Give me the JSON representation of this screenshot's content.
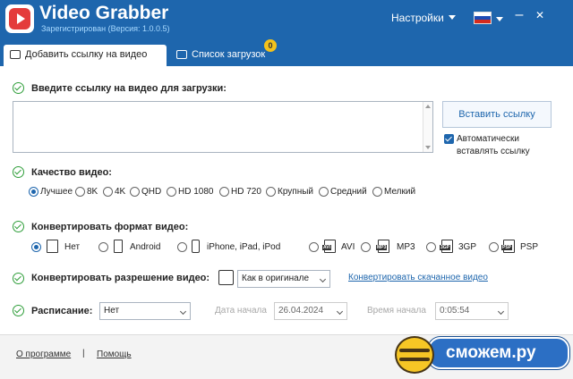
{
  "app": {
    "title": "Video Grabber",
    "subtitle": "Зарегистрирован (Версия: 1.0.0.5)",
    "settings_label": "Настройки",
    "language_flag": "ru-flag",
    "minimize_symbol": "–",
    "close_symbol": "✕"
  },
  "tabs": [
    {
      "label": "Добавить ссылку на видео",
      "active": true,
      "icon": "add-video-icon"
    },
    {
      "label": "Список загрузок",
      "active": false,
      "icon": "download-list-icon",
      "badge": "0"
    }
  ],
  "url_section": {
    "label": "Введите ссылку на видео для загрузки:",
    "input_value": "",
    "paste_button": "Вставить ссылку",
    "auto_paste_label": "Автоматически вставлять ссылку",
    "auto_paste_checked": true
  },
  "quality": {
    "label": "Качество видео:",
    "options": [
      "Лучшее",
      "8K",
      "4K",
      "QHD",
      "HD 1080",
      "HD 720",
      "Крупный",
      "Средний",
      "Мелкий"
    ],
    "selected": "Лучшее"
  },
  "format": {
    "label": "Конвертировать формат видео:",
    "options": [
      "Нет",
      "Android",
      "iPhone, iPad, iPod",
      "AVI",
      "MP3",
      "3GP",
      "PSP"
    ],
    "icon_badges": [
      "AVI",
      "MP3",
      "3GP",
      "PSP"
    ],
    "selected": "Нет"
  },
  "resolution": {
    "label": "Конвертировать разрешение видео:",
    "select_value": "Как в оригинале",
    "link": "Конвертировать скачанное видео"
  },
  "schedule": {
    "label": "Расписание:",
    "select_value": "Нет",
    "start_date_label": "Дата начала",
    "start_date": "26.04.2024",
    "start_time_label": "Время начала",
    "start_time": "0:05:54"
  },
  "footer": {
    "about": "О программе",
    "separator": "|",
    "help": "Помощь"
  },
  "watermark": {
    "text": "сможем.ру"
  },
  "colors": {
    "brand_blue": "#1e66ad",
    "check_green": "#2f9e3a",
    "badge_yellow": "#f4c21b",
    "logo_red": "#e43b3b"
  }
}
